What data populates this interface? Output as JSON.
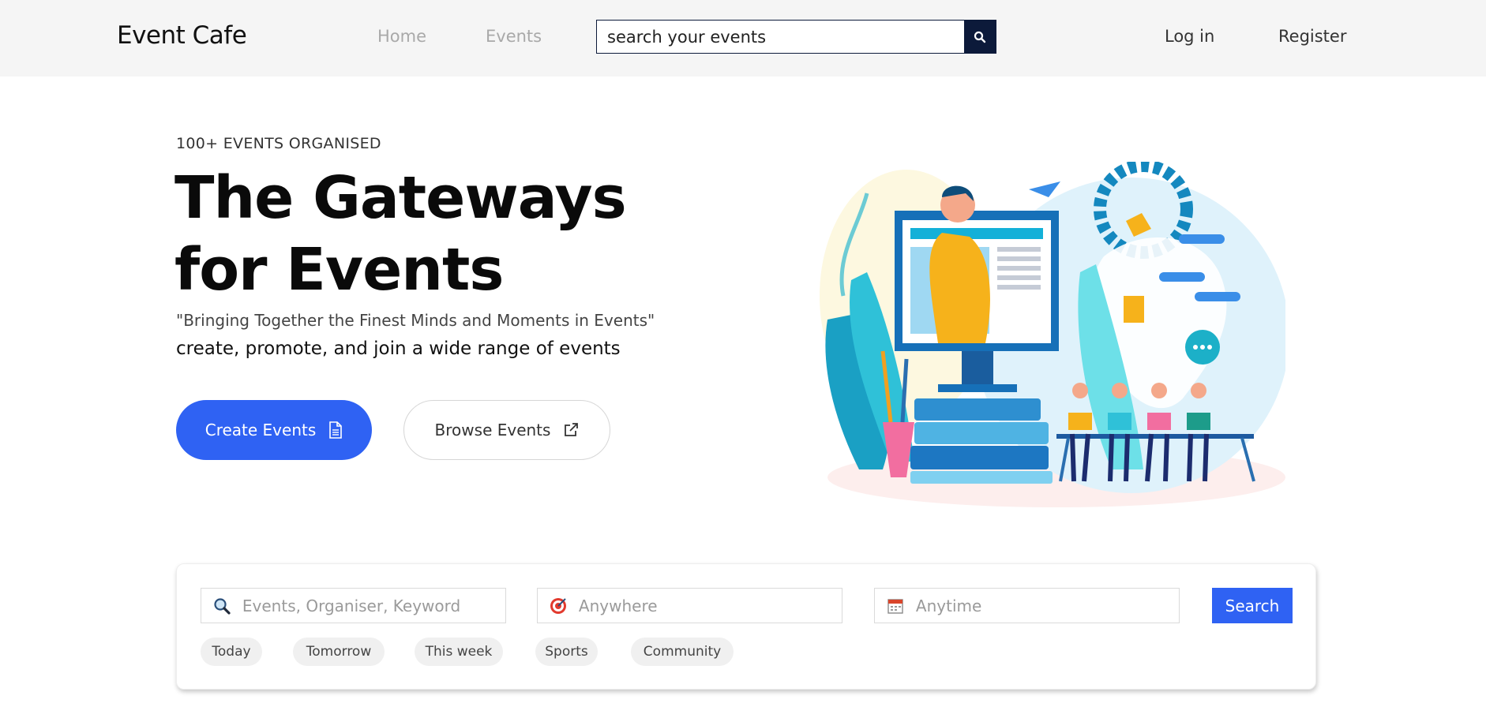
{
  "navbar": {
    "brand": "Event Cafe",
    "links": [
      "Home",
      "Events"
    ],
    "search_placeholder": "search your events",
    "login": "Log in",
    "register": "Register"
  },
  "hero": {
    "eyebrow": "100+ EVENTS ORGANISED",
    "title_line1": "The Gateways",
    "title_line2": "for Events",
    "quote": "\"Bringing Together the Finest Minds and Moments in Events\"",
    "subline": "create, promote, and join a wide range of events",
    "create_button": "Create Events",
    "browse_button": "Browse Events"
  },
  "search_panel": {
    "keyword_placeholder": "Events, Organiser, Keyword",
    "location_placeholder": "Anywhere",
    "date_placeholder": "Anytime",
    "search_button": "Search",
    "chips": [
      "Today",
      "Tomorrow",
      "This week",
      "Sports",
      "Community"
    ]
  },
  "colors": {
    "primary": "#2f62f3",
    "navy": "#0c1a3a",
    "navbar_bg": "#f5f5f5"
  },
  "icons": {
    "nav_search": "search-icon",
    "create": "document-icon",
    "browse": "external-link-icon",
    "keyword": "magnifier-icon",
    "location": "target-icon",
    "date": "calendar-icon"
  }
}
